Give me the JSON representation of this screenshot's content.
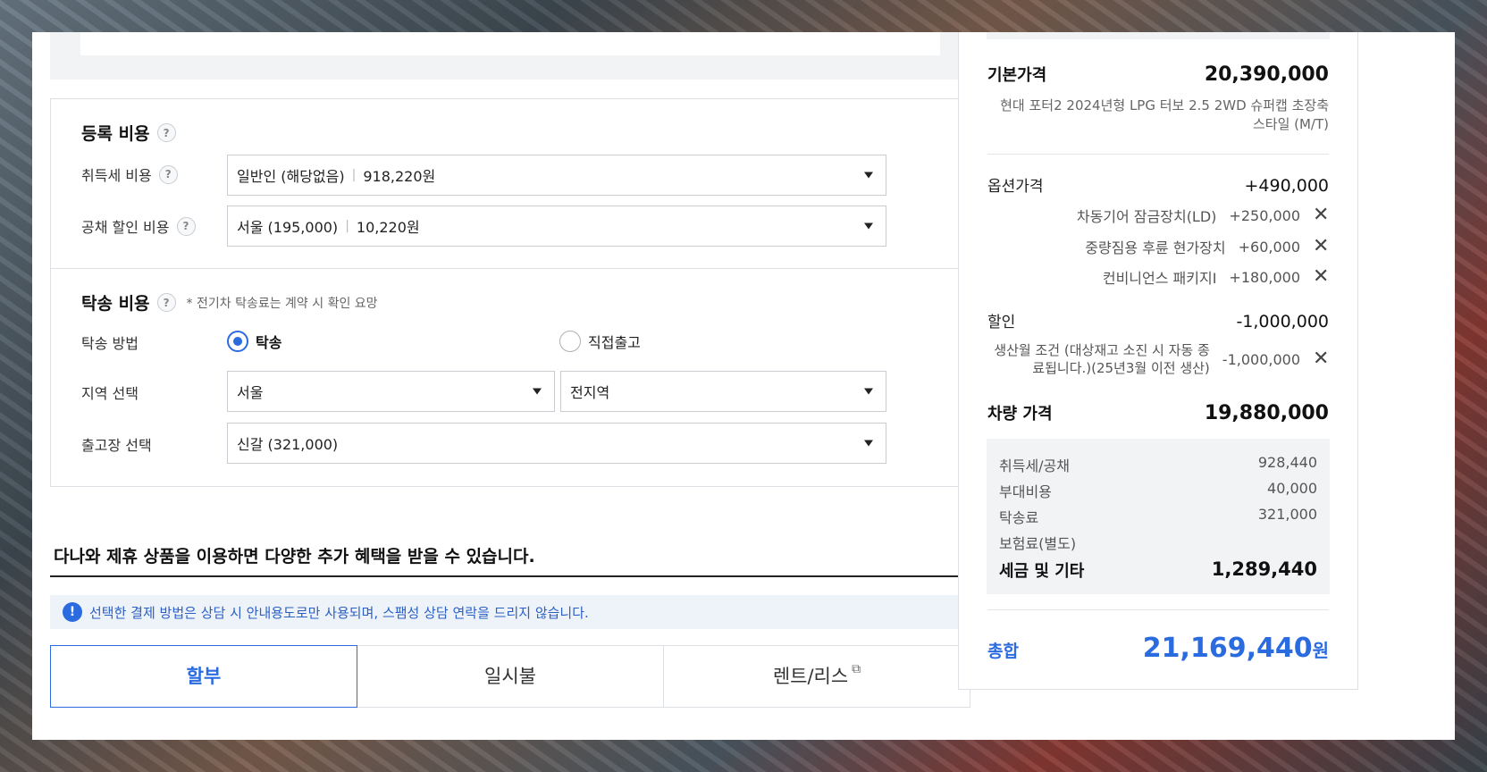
{
  "registration": {
    "title": "등록 비용",
    "acquisition_label": "취득세 비용",
    "acquisition_value": "일반인 (해당없음)",
    "acquisition_amount": "918,220원",
    "bond_label": "공채 할인 비용",
    "bond_value": "서울 (195,000)",
    "bond_amount": "10,220원"
  },
  "delivery": {
    "title": "탁송 비용",
    "note": "* 전기차 탁송료는 계약 시 확인 요망",
    "method_label": "탁송 방법",
    "option_delivery": "탁송",
    "option_pickup": "직접출고",
    "region_label": "지역 선택",
    "region_value": "서울",
    "district_value": "전지역",
    "center_label": "출고장 선택",
    "center_value": "신갈 (321,000)"
  },
  "promo": {
    "title": "다나와 제휴 상품을 이용하면 다양한 추가 혜택을 받을 수 있습니다.",
    "info": "선택한 결제 방법은 상담 시 안내용도로만 사용되며, 스팸성 상담 연락을 드리지 않습니다.",
    "tabs": [
      "할부",
      "일시불",
      "렌트/리스"
    ]
  },
  "summary": {
    "base_label": "기본가격",
    "base_value": "20,390,000",
    "base_desc": "현대 포터2 2024년형 LPG 터보 2.5 2WD 슈퍼캡 초장축 스타일 (M/T)",
    "option_label": "옵션가격",
    "option_value": "+490,000",
    "options": [
      {
        "name": "차동기어 잠금장치(LD)",
        "price": "+250,000"
      },
      {
        "name": "중량짐용 후륜 현가장치",
        "price": "+60,000"
      },
      {
        "name": "컨비니언스 패키지I",
        "price": "+180,000"
      }
    ],
    "discount_label": "할인",
    "discount_value": "-1,000,000",
    "discount_item_line1": "생산월 조건 (대상재고 소진 시 자동 종",
    "discount_item_line2": "료됩니다.)(25년3월 이전 생산)",
    "discount_item_price": "-1,000,000",
    "vehicle_label": "차량 가격",
    "vehicle_value": "19,880,000",
    "tax_rows": [
      {
        "label": "취득세/공채",
        "value": "928,440"
      },
      {
        "label": "부대비용",
        "value": "40,000"
      },
      {
        "label": "탁송료",
        "value": "321,000"
      },
      {
        "label": "보험료(별도)",
        "value": ""
      }
    ],
    "tax_total_label": "세금 및 기타",
    "tax_total_value": "1,289,440",
    "grand_label": "총합",
    "grand_value": "21,169,440",
    "grand_unit": "원"
  },
  "colors": {
    "accent": "#2b6be0",
    "border": "#dcdfe3",
    "panel_bg": "#f2f3f5"
  }
}
